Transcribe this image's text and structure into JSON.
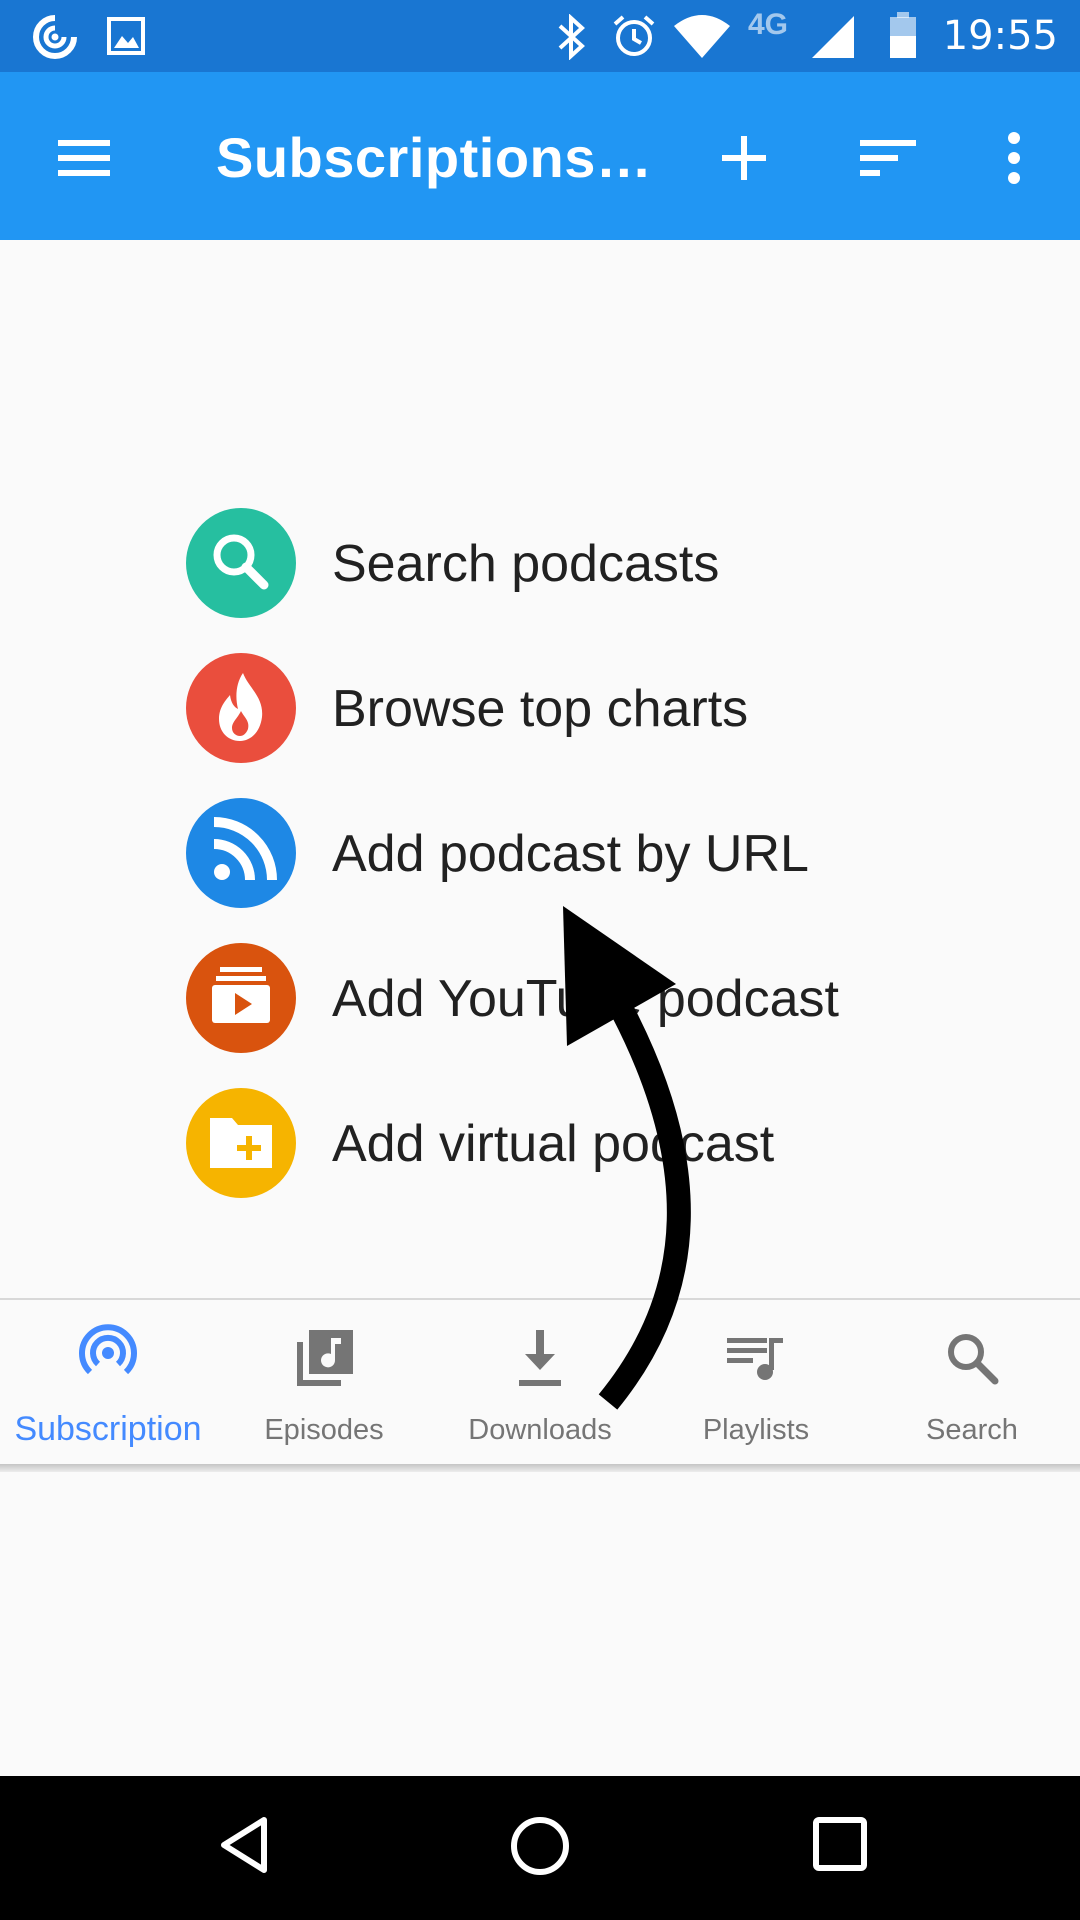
{
  "status_bar": {
    "time": "19:55",
    "network": "4G",
    "icons": [
      "podcast-app-icon",
      "image-icon",
      "bluetooth-icon",
      "alarm-icon",
      "wifi-icon",
      "cell-signal-icon",
      "battery-icon"
    ]
  },
  "app_bar": {
    "title": "Subscriptions…",
    "icons": [
      "menu-icon",
      "add-icon",
      "sort-icon",
      "more-vert-icon"
    ]
  },
  "menu": {
    "items": [
      {
        "label": "Search podcasts",
        "icon": "search-icon",
        "color": "#26BFA0"
      },
      {
        "label": "Browse top charts",
        "icon": "flame-icon",
        "color": "#EA4E3D"
      },
      {
        "label": "Add podcast by URL",
        "icon": "rss-icon",
        "color": "#1E88E5"
      },
      {
        "label": "Add YouTube podcast",
        "icon": "youtube-icon",
        "color": "#D9530E"
      },
      {
        "label": "Add virtual podcast",
        "icon": "folder-add-icon",
        "color": "#F6B400"
      }
    ]
  },
  "bottom_nav": {
    "items": [
      {
        "label": "Subscription",
        "icon": "subscription-icon",
        "active": true
      },
      {
        "label": "Episodes",
        "icon": "episodes-icon",
        "active": false
      },
      {
        "label": "Downloads",
        "icon": "download-icon",
        "active": false
      },
      {
        "label": "Playlists",
        "icon": "playlist-icon",
        "active": false
      },
      {
        "label": "Search",
        "icon": "search-icon",
        "active": false
      }
    ],
    "active_color": "#448AFF",
    "inactive_color": "#757575"
  },
  "system_nav": {
    "icons": [
      "back-icon",
      "home-icon",
      "recents-icon"
    ]
  },
  "colors": {
    "status_bar": "#1976D2",
    "app_bar": "#2196F3",
    "annotation_arrow": "#000000"
  }
}
